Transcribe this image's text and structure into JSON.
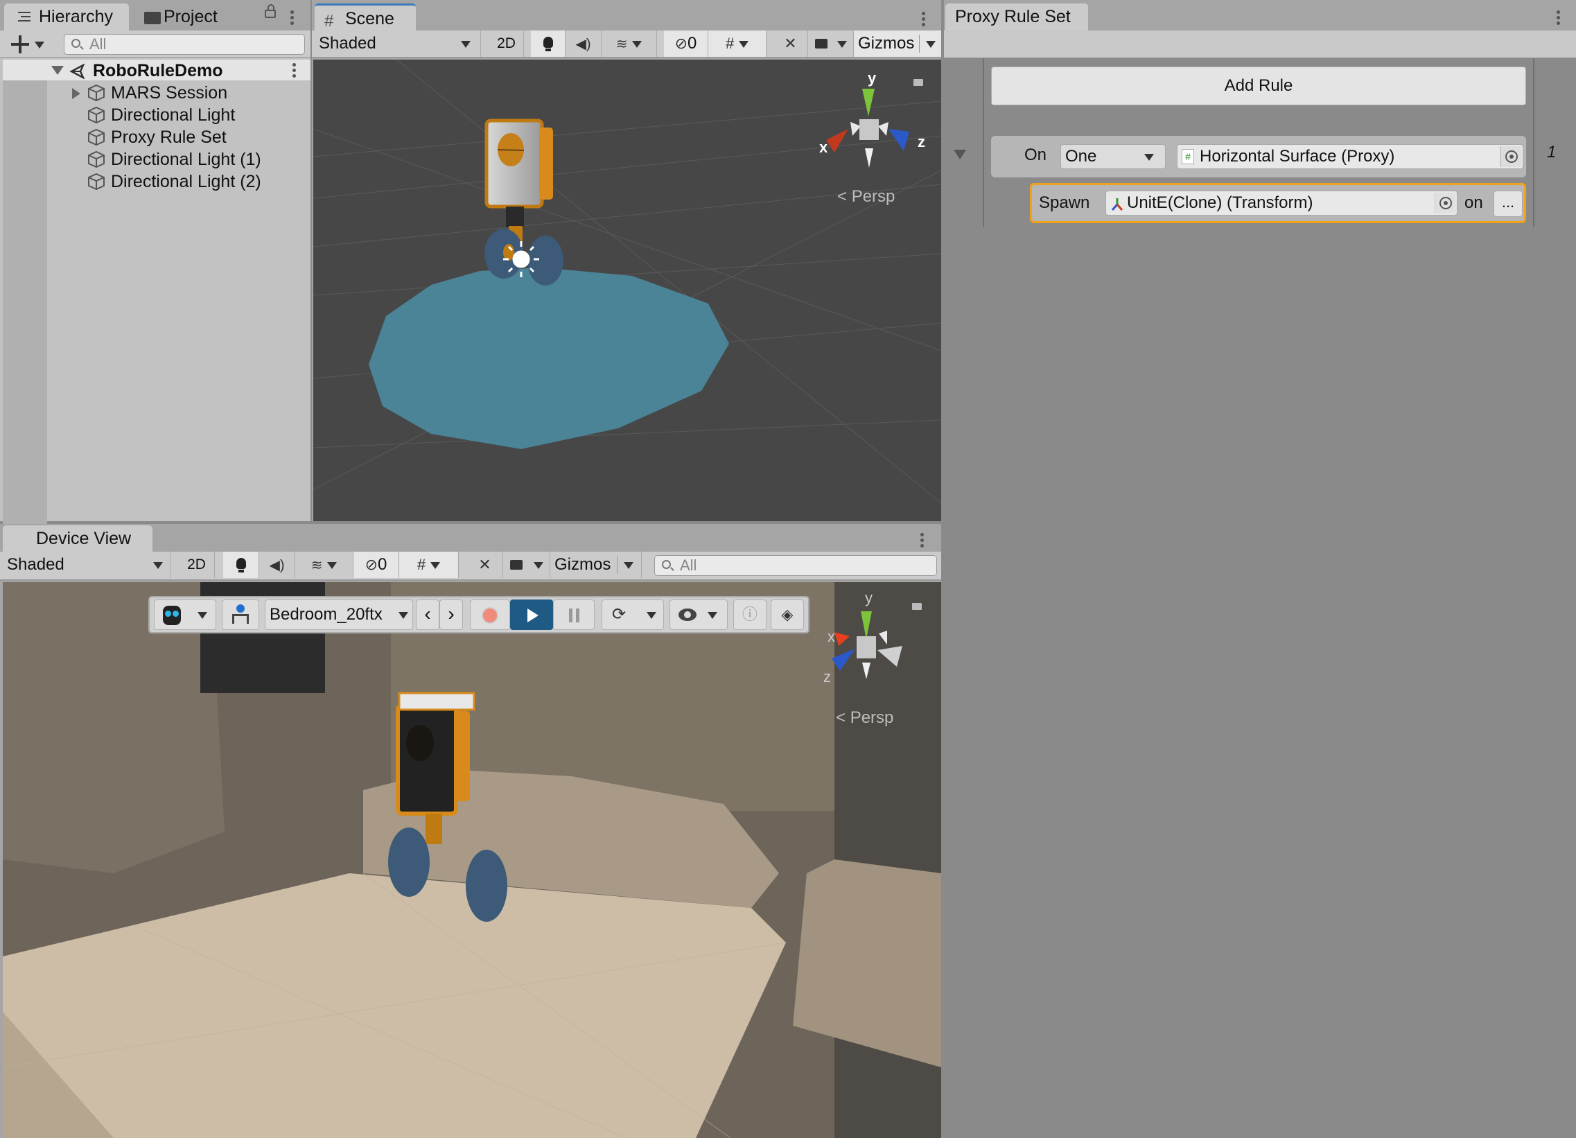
{
  "hierarchy": {
    "tabs": [
      {
        "label": "Hierarchy",
        "icon": "hierarchy-list-icon"
      },
      {
        "label": "Project",
        "icon": "folder-icon"
      }
    ],
    "search_placeholder": "All",
    "scene_name": "RoboRuleDemo",
    "items": [
      {
        "label": "MARS Session",
        "expandable": true
      },
      {
        "label": "Directional Light",
        "expandable": false
      },
      {
        "label": "Proxy Rule Set",
        "expandable": false
      },
      {
        "label": "Directional Light (1)",
        "expandable": false
      },
      {
        "label": "Directional Light (2)",
        "expandable": false
      }
    ]
  },
  "scene": {
    "tab_label": "Scene",
    "shading": "Shaded",
    "mode_2d": "2D",
    "hidden_count": "0",
    "gizmos_label": "Gizmos",
    "axis_labels": {
      "x": "x",
      "y": "y",
      "z": "z"
    },
    "projection": "Persp"
  },
  "proxy_rule_set": {
    "tab_label": "Proxy Rule Set",
    "add_rule_label": "Add Rule",
    "rule": {
      "on_label": "On",
      "match_count": "One",
      "proxy_field": "Horizontal Surface (Proxy)",
      "index": "1",
      "spawn_label": "Spawn",
      "spawn_field": "UnitE(Clone) (Transform)",
      "on_suffix": "on",
      "more_label": "..."
    }
  },
  "device_view": {
    "tab_label": "Device View",
    "shading": "Shaded",
    "mode_2d": "2D",
    "hidden_count": "0",
    "gizmos_label": "Gizmos",
    "search_placeholder": "All",
    "simulation": {
      "environment": "Bedroom_20ftx",
      "accent": "#1f5a85"
    },
    "axis_labels": {
      "x": "x",
      "y": "y",
      "z": "z"
    },
    "projection": "Persp"
  },
  "colors": {
    "selection_orange": "#f0a21a",
    "proxy_surface": "#4b8aa0",
    "play_active": "#1f5a85"
  }
}
